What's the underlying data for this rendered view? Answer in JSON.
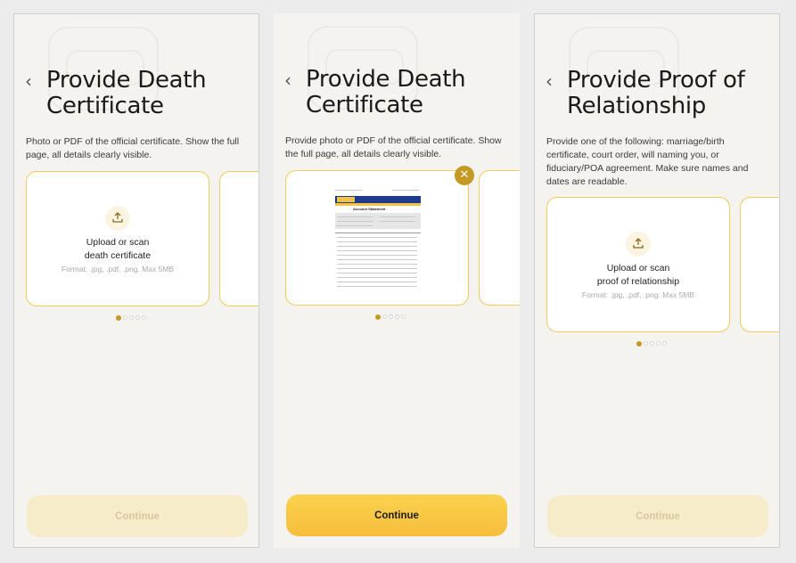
{
  "screens": [
    {
      "title": "Provide Death Certificate",
      "description": "Photo or PDF of the official certificate. Show the full page, all details clearly visible.",
      "upload_label_1": "Upload or scan",
      "upload_label_2": "death certificate",
      "format": "Format: .jpg, .pdf, .png. Max 5MB",
      "continue_label": "Continue",
      "continue_state": "disabled",
      "active_dot": 1,
      "dot_count": 5
    },
    {
      "title": "Provide Death Certificate",
      "description": "Provide photo or PDF of the official certificate. Show the full page, all details clearly visible.",
      "continue_label": "Continue",
      "continue_state": "enabled",
      "active_dot": 1,
      "dot_count": 5,
      "document": {
        "heading": "Account Statement",
        "bank": "Outfield BANK"
      }
    },
    {
      "title": "Provide Proof of Relationship",
      "description": "Provide one of the following: marriage/birth certificate, court order, will naming you, or fiduciary/POA agreement. Make sure names and dates are readable.",
      "upload_label_1": "Upload or scan",
      "upload_label_2": "proof of relationship",
      "format": "Format: .jpg, .pdf, .png. Max 5MB",
      "continue_label": "Continue",
      "continue_state": "disabled",
      "active_dot": 1,
      "dot_count": 5
    }
  ],
  "icons": {
    "back": "chevron-left-icon",
    "upload": "upload-icon",
    "close": "close-icon"
  },
  "colors": {
    "accent": "#c49a24",
    "card_border": "#f0cc5a",
    "button_enabled": "#f8c842",
    "button_disabled": "#f6ecca"
  }
}
